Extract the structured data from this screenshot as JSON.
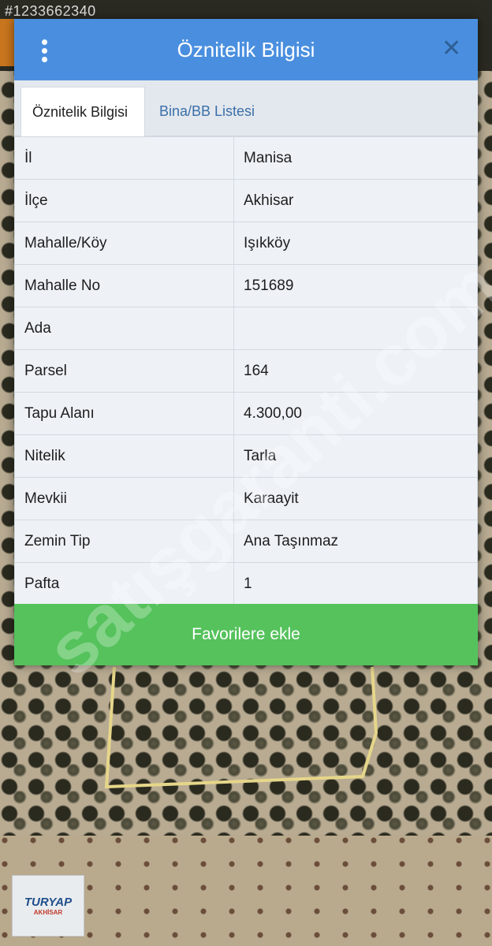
{
  "listing_id": "#1233662340",
  "header": {
    "title": "Öznitelik Bilgisi",
    "menu_icon": "more-vertical-icon",
    "close_icon": "close-icon"
  },
  "tabs": [
    {
      "label": "Öznitelik Bilgisi",
      "active": true
    },
    {
      "label": "Bina/BB Listesi",
      "active": false
    }
  ],
  "rows": [
    {
      "key": "İl",
      "value": "Manisa"
    },
    {
      "key": "İlçe",
      "value": "Akhisar"
    },
    {
      "key": "Mahalle/Köy",
      "value": "Işıkköy"
    },
    {
      "key": "Mahalle No",
      "value": "151689"
    },
    {
      "key": "Ada",
      "value": ""
    },
    {
      "key": "Parsel",
      "value": "164"
    },
    {
      "key": "Tapu Alanı",
      "value": "4.300,00"
    },
    {
      "key": "Nitelik",
      "value": "Tarla"
    },
    {
      "key": "Mevkii",
      "value": "Karaayit"
    },
    {
      "key": "Zemin Tip",
      "value": "Ana Taşınmaz"
    },
    {
      "key": "Pafta",
      "value": "1"
    }
  ],
  "favorite_button": "Favorilere ekle",
  "watermark": "satışgaranti.com",
  "logo": {
    "name": "TURYAP",
    "sub": "AKHİSAR"
  },
  "colors": {
    "header": "#4a8fdf",
    "button": "#55c25c",
    "tab_link": "#3b6fa8"
  }
}
